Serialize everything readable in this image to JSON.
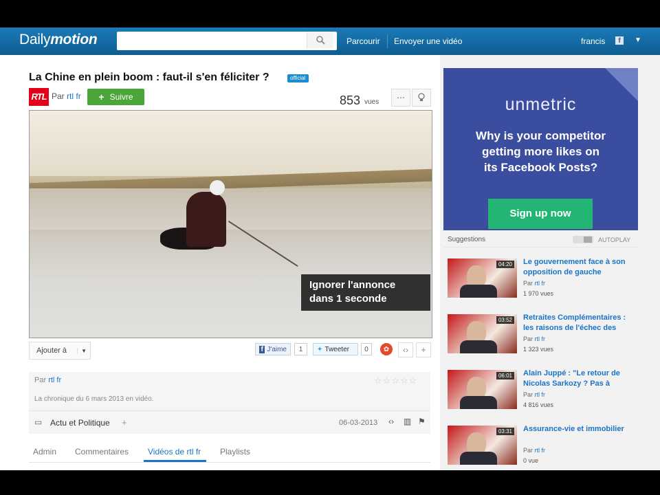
{
  "header": {
    "logo_prefix": "Daily",
    "logo_suffix": "motion",
    "search_placeholder": "",
    "nav": [
      "Parcourir",
      "Envoyer une vidéo"
    ],
    "user": "francis"
  },
  "video": {
    "title": "La Chine en plein boom : faut-il s'en féliciter ?",
    "badge": "official",
    "channel_logo": "RTL",
    "by_prefix": "Par",
    "channel": "rtl fr",
    "follow_label": "Suivre",
    "views": "853",
    "views_label": "vues",
    "skip_ad_line1": "Ignorer l'annonce",
    "skip_ad_line2": "dans 1 seconde"
  },
  "actions": {
    "add_to": "Ajouter à",
    "like": "J'aime",
    "like_count": "1",
    "tweet": "Tweeter",
    "tweet_count": "0"
  },
  "info": {
    "by_prefix": "Par",
    "channel": "rtl fr",
    "description": "La chronique du 6 mars 2013 en vidéo.",
    "category": "Actu et Politique",
    "date": "06-03-2013"
  },
  "tabs": [
    "Admin",
    "Commentaires",
    "Vidéos de rtl fr",
    "Playlists"
  ],
  "ad": {
    "brand": "unmetric",
    "line1": "Why is your competitor",
    "line2": "getting more likes on",
    "line3": "its Facebook Posts?",
    "cta": "Sign up now"
  },
  "suggestions": {
    "heading": "Suggestions",
    "autoplay": "AUTOPLAY",
    "items": [
      {
        "duration": "04:20",
        "title": "Le gouvernement face à son opposition de gauche",
        "by": "Par",
        "channel": "rtl fr",
        "views": "1 970 vues"
      },
      {
        "duration": "03:52",
        "title": "Retraites Complémentaires : les raisons de l'échec des",
        "by": "Par",
        "channel": "rtl fr",
        "views": "1 323 vues"
      },
      {
        "duration": "06:01",
        "title": "Alain Juppé : \"Le retour de Nicolas Sarkozy ? Pas à",
        "by": "Par",
        "channel": "rtl fr",
        "views": "4 816 vues"
      },
      {
        "duration": "03:31",
        "title": "Assurance-vie et immobilier",
        "by": "Par",
        "channel": "rtl fr",
        "views": "0 vue"
      }
    ]
  },
  "colors": {
    "brand": "#136ba2",
    "link": "#1a73c7",
    "follow": "#4ba63a",
    "ad_bg": "#3a4d9f",
    "cta": "#22b573"
  }
}
